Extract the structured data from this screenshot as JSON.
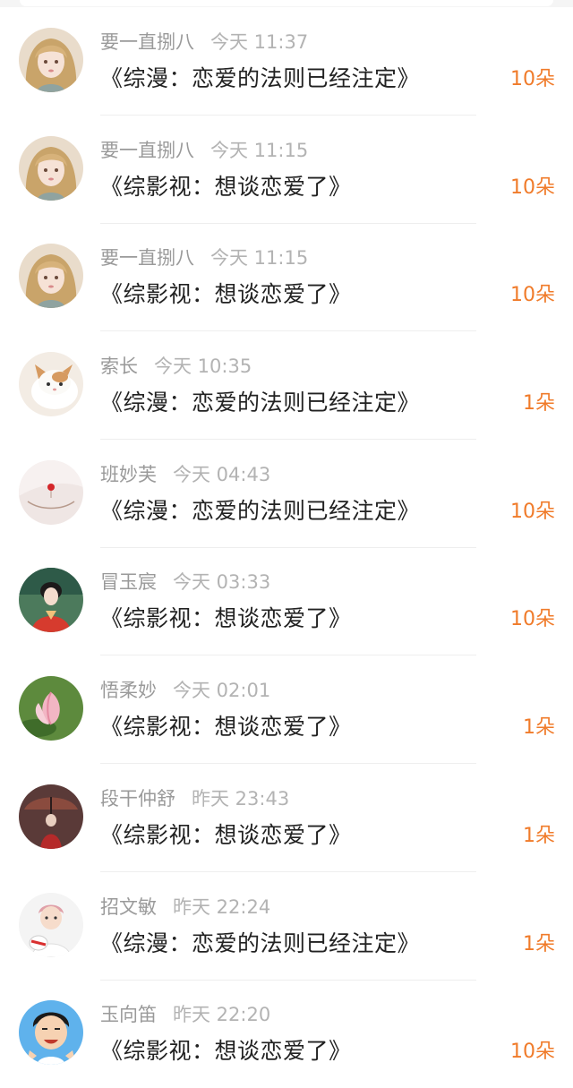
{
  "rows": [
    {
      "name": "要一直捌八",
      "time": "今天 11:37",
      "title": "《综漫：恋爱的法则已经注定》",
      "gift": "10朵",
      "avatar": "anime-girl-avatar"
    },
    {
      "name": "要一直捌八",
      "time": "今天 11:15",
      "title": "《综影视：想谈恋爱了》",
      "gift": "10朵",
      "avatar": "anime-girl-avatar"
    },
    {
      "name": "要一直捌八",
      "time": "今天 11:15",
      "title": "《综影视：想谈恋爱了》",
      "gift": "10朵",
      "avatar": "anime-girl-avatar"
    },
    {
      "name": "索长",
      "time": "今天 10:35",
      "title": "《综漫：恋爱的法则已经注定》",
      "gift": "1朵",
      "avatar": "cat-avatar"
    },
    {
      "name": "班妙芙",
      "time": "今天 04:43",
      "title": "《综漫：恋爱的法则已经注定》",
      "gift": "10朵",
      "avatar": "necklace-avatar"
    },
    {
      "name": "冒玉宸",
      "time": "今天 03:33",
      "title": "《综影视：想谈恋爱了》",
      "gift": "10朵",
      "avatar": "costume-woman-avatar"
    },
    {
      "name": "悟柔妙",
      "time": "今天 02:01",
      "title": "《综影视：想谈恋爱了》",
      "gift": "1朵",
      "avatar": "lotus-avatar"
    },
    {
      "name": "段干仲舒",
      "time": "昨天 23:43",
      "title": "《综影视：想谈恋爱了》",
      "gift": "1朵",
      "avatar": "umbrella-figure-avatar"
    },
    {
      "name": "招文敏",
      "time": "昨天 22:24",
      "title": "《综漫：恋爱的法则已经注定》",
      "gift": "1朵",
      "avatar": "boy-with-toy-avatar"
    },
    {
      "name": "玉向笛",
      "time": "昨天 22:20",
      "title": "《综影视：想谈恋爱了》",
      "gift": "10朵",
      "avatar": "cartoon-boy-avatar"
    }
  ],
  "colors": {
    "gift": "#f07b2a",
    "meta": "#9a9a9a",
    "title": "#222222",
    "divider": "#eeeeee"
  }
}
